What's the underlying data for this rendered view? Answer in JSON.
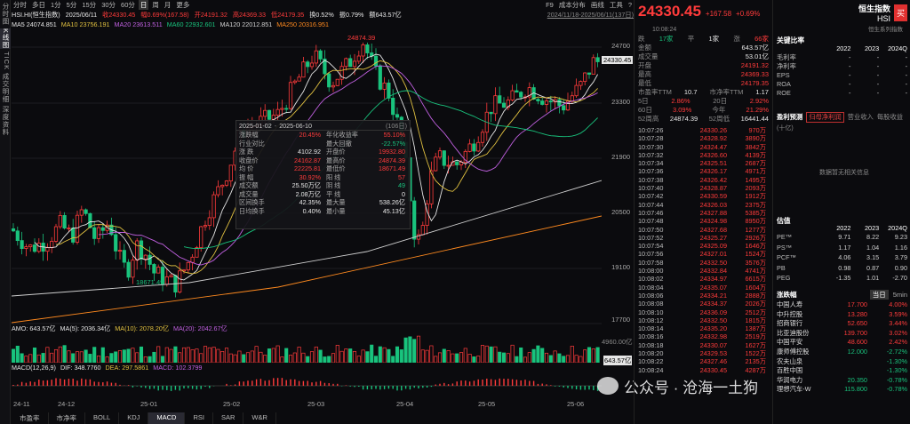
{
  "left_tabs": [
    "分时图",
    "K线图",
    "TICK",
    "成交明细",
    "深度资料"
  ],
  "toolbar": {
    "items": [
      "分时",
      "多日",
      "1分",
      "5分",
      "15分",
      "30分",
      "60分",
      "日",
      "周",
      "月",
      "更多"
    ],
    "active": "日",
    "right": [
      "F9",
      "成本分布",
      "画线",
      "工具",
      "?"
    ]
  },
  "info": {
    "date": "2025/06/11",
    "code": "HSI.HI(恒生指数)",
    "close": "收24330.45",
    "chg": "幅0.69%(167.58)",
    "open": "开24191.32",
    "high": "高24369.33",
    "low": "低24179.35",
    "turn": "换0.52%",
    "amp": "振0.79%",
    "amount": "额643.57亿",
    "range": "2024/11/18-2025/06/11(137日)"
  },
  "ma": [
    {
      "label": "MA5 24074.851",
      "color": "#e6e6e6"
    },
    {
      "label": "MA10 23756.191",
      "color": "#e0c040"
    },
    {
      "label": "MA20 23613.511",
      "color": "#c060e0"
    },
    {
      "label": "MA60 22932.601",
      "color": "#19c37d"
    },
    {
      "label": "MA120 22012.851",
      "color": "#cfcfcf"
    },
    {
      "label": "MA250 20316.951",
      "color": "#ff8a1f"
    }
  ],
  "yaxis": [
    "24700",
    "23300",
    "21900",
    "20500",
    "19100",
    "17700"
  ],
  "last_price_tag": "24330.45",
  "high_label": "24874.39",
  "low_label": "18671.49",
  "popup": {
    "from": "2025-01-02",
    "to": "2025-06-10",
    "days": "(106日)",
    "rows": [
      [
        "涨跌幅",
        "20.45%",
        "年化收益率",
        "55.10%"
      ],
      [
        "行业对比",
        "",
        "最大回撤",
        "-22.57%"
      ],
      [
        "涨 跌",
        "4102.92",
        "开盘价",
        "19932.80"
      ],
      [
        "收盘价",
        "24162.87",
        "最高价",
        "24874.39"
      ],
      [
        "均 价",
        "22225.81",
        "最低价",
        "18671.49"
      ],
      [
        "振 幅",
        "30.92%",
        "阳 线",
        "57"
      ],
      [
        "成交额",
        "25.50万亿",
        "阴 线",
        "49"
      ],
      [
        "成交量",
        "2.08万亿",
        "平 线",
        "0"
      ],
      [
        "区间换手",
        "42.35%",
        "最大量",
        "538.26亿"
      ],
      [
        "日均换手",
        "0.40%",
        "最小量",
        "45.13亿"
      ]
    ]
  },
  "amo": {
    "label": "AMO: 643.57亿",
    "ma5": "MA(5): 2036.34亿",
    "ma10": "MA(10): 2078.20亿",
    "ma20": "MA(20): 2042.67亿",
    "axis_top": "4960.00亿",
    "axis_last": "643.57亿"
  },
  "macd": {
    "label": "MACD(12,26,9)",
    "dif": "DIF: 348.7760",
    "dea": "DEA: 297.5861",
    "macd": "MACD: 102.3799"
  },
  "xaxis": [
    "24-11",
    "24-12",
    "25-01",
    "25-02",
    "25-03",
    "25-04",
    "25-05",
    "25-06"
  ],
  "bottom_tabs": [
    "市盈率",
    "市净率",
    "BOLL",
    "KDJ",
    "MACD",
    "RSI",
    "SAR",
    "W&R"
  ],
  "bottom_active": "MACD",
  "watermark": "公众号 · 沧海一土狗",
  "quote": {
    "price": "24330.45",
    "chg": "+167.58",
    "pct": "+0.69%",
    "name": "恒生指数",
    "code": "HSI",
    "time": "10:08:24",
    "series": "恒生系列指数",
    "buy": "买",
    "tabs": [
      "跌",
      "17家",
      "平",
      "1家",
      "涨",
      "66家"
    ],
    "rows": [
      [
        "金额",
        "643.57亿"
      ],
      [
        "成交量",
        "53.01亿"
      ],
      [
        "开盘",
        "24191.32"
      ],
      [
        "最高",
        "24369.33"
      ],
      [
        "最低",
        "24179.35"
      ]
    ],
    "pe": [
      "市盈率TTM",
      "10.7",
      "市净率TTM",
      "1.17"
    ],
    "perf": [
      [
        "5日",
        "2.86%",
        "20日",
        "2.92%"
      ],
      [
        "60日",
        "3.09%",
        "今年",
        "21.29%"
      ],
      [
        "52周高",
        "24874.39",
        "52周低",
        "16441.44"
      ]
    ]
  },
  "ticks": [
    [
      "10:07:26",
      "24330.26",
      "970万"
    ],
    [
      "10:07:28",
      "24328.92",
      "3890万"
    ],
    [
      "10:07:30",
      "24324.47",
      "3842万"
    ],
    [
      "10:07:32",
      "24326.60",
      "4139万"
    ],
    [
      "10:07:34",
      "24325.51",
      "2687万"
    ],
    [
      "10:07:36",
      "24326.17",
      "4971万"
    ],
    [
      "10:07:38",
      "24326.42",
      "1495万"
    ],
    [
      "10:07:40",
      "24328.87",
      "2093万"
    ],
    [
      "10:07:42",
      "24330.59",
      "1912万"
    ],
    [
      "10:07:44",
      "24326.03",
      "2375万"
    ],
    [
      "10:07:46",
      "24327.88",
      "5385万"
    ],
    [
      "10:07:48",
      "24324.98",
      "8950万"
    ],
    [
      "10:07:50",
      "24327.68",
      "1277万"
    ],
    [
      "10:07:52",
      "24325.27",
      "2926万"
    ],
    [
      "10:07:54",
      "24325.09",
      "1646万"
    ],
    [
      "10:07:56",
      "24327.01",
      "1524万"
    ],
    [
      "10:07:58",
      "24332.50",
      "3576万"
    ],
    [
      "10:08:00",
      "24332.84",
      "4741万"
    ],
    [
      "10:08:02",
      "24334.97",
      "6615万"
    ],
    [
      "10:08:04",
      "24335.07",
      "1604万"
    ],
    [
      "10:08:06",
      "24334.21",
      "2888万"
    ],
    [
      "10:08:08",
      "24334.37",
      "2026万"
    ],
    [
      "10:08:10",
      "24336.09",
      "2512万"
    ],
    [
      "10:08:12",
      "24332.50",
      "1815万"
    ],
    [
      "10:08:14",
      "24335.20",
      "1387万"
    ],
    [
      "10:08:16",
      "24332.98",
      "2519万"
    ],
    [
      "10:08:18",
      "24330.07",
      "1627万"
    ],
    [
      "10:08:20",
      "24329.53",
      "1522万"
    ],
    [
      "10:08:22",
      "24327.46",
      "2135万"
    ],
    [
      "10:08:24",
      "24330.45",
      "4287万"
    ]
  ],
  "fin": {
    "title": "关键比率",
    "years": [
      "2022",
      "2023",
      "2024Q"
    ],
    "rows": [
      [
        "毛利率",
        "-",
        "-",
        "-"
      ],
      [
        "净利率",
        "-",
        "-",
        "-"
      ],
      [
        "EPS",
        "-",
        "-",
        "-"
      ],
      [
        "ROA",
        "-",
        "-",
        "-"
      ],
      [
        "ROE",
        "-",
        "-",
        "-"
      ]
    ]
  },
  "profit": {
    "title": "盈利预测",
    "sub": "(十亿)",
    "btn1": "归母净利润",
    "btn2": "营业收入",
    "btn3": "每股收益",
    "empty": "数据暂无相关信息"
  },
  "valuation": {
    "title": "估值",
    "years": [
      "2022",
      "2023",
      "2024Q"
    ],
    "rows": [
      [
        "PE™",
        "9.71",
        "8.22",
        "9.23"
      ],
      [
        "PS™",
        "1.17",
        "1.04",
        "1.16"
      ],
      [
        "PCF™",
        "4.06",
        "3.15",
        "3.79"
      ],
      [
        "PB",
        "0.98",
        "0.87",
        "0.90"
      ],
      [
        "PEG",
        "-1.35",
        "1.01",
        "-2.70"
      ]
    ]
  },
  "constituents": {
    "title": "涨跌幅",
    "btn1": "当日",
    "btn2": "5min",
    "rows": [
      [
        "中国人寿",
        "17.700",
        "4.00%"
      ],
      [
        "中升控股",
        "13.280",
        "3.59%"
      ],
      [
        "招商银行",
        "52.650",
        "3.44%"
      ],
      [
        "比亚迪股份",
        "139.700",
        "3.02%"
      ],
      [
        "中国平安",
        "48.600",
        "2.42%"
      ],
      [
        "康师傅控股",
        "12.000",
        "-2.72%"
      ],
      [
        "农夫山泉",
        "",
        "-1.30%"
      ],
      [
        "百胜中国",
        "",
        "-1.30%"
      ],
      [
        "华润电力",
        "20.350",
        "-0.78%"
      ],
      [
        "理想汽车-W",
        "115.800",
        "-0.78%"
      ]
    ]
  }
}
